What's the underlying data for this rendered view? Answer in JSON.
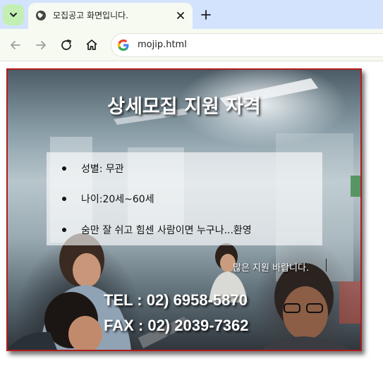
{
  "browser": {
    "tab_title": "모집공고 화면입니다.",
    "url": "mojip.html"
  },
  "hero": {
    "title": "상세모집 지원 자격",
    "criteria": [
      "성별: 무관",
      "나이:20세~60세",
      "숨만 잘 쉬고 힘센 사람이면 누구나...환영"
    ],
    "welcome": "많은 지원 바랍니다.",
    "tel": "TEL : 02) 6958-5870",
    "fax": "FAX : 02) 2039-7362"
  },
  "colors": {
    "tabstrip": "#d3e3fd",
    "toolbar": "#f6faf0",
    "frame_border": "#b01c1c"
  }
}
